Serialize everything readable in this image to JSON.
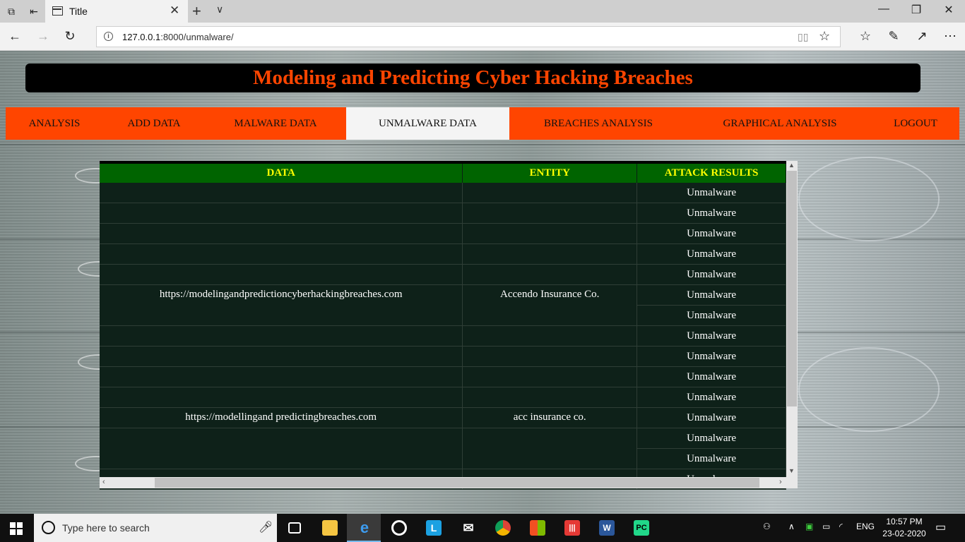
{
  "browser": {
    "tab_title": "Title",
    "url_host": "127.0.0.1",
    "url_rest": ":8000/unmalware/"
  },
  "page": {
    "title": "Modeling and Predicting Cyber Hacking Breaches",
    "menu": [
      {
        "label": "ANALYSIS"
      },
      {
        "label": "ADD DATA"
      },
      {
        "label": "MALWARE DATA"
      },
      {
        "label": "UNMALWARE DATA",
        "active": true
      },
      {
        "label": "BREACHES ANALYSIS"
      },
      {
        "label": "GRAPHICAL ANALYSIS"
      },
      {
        "label": "LOGOUT"
      }
    ],
    "table": {
      "headers": [
        "DATA",
        "ENTITY",
        "ATTACK RESULTS"
      ],
      "groups": [
        {
          "data": "",
          "entity": "",
          "results": [
            "Unmalware"
          ]
        },
        {
          "data": "",
          "entity": "",
          "results": [
            "Unmalware"
          ]
        },
        {
          "data": "",
          "entity": "",
          "results": [
            "Unmalware"
          ]
        },
        {
          "data": "",
          "entity": "",
          "results": [
            "Unmalware"
          ]
        },
        {
          "data": "",
          "entity": "",
          "results": [
            "Unmalware"
          ]
        },
        {
          "data": "https://modelingandpredictioncyberhackingbreaches.com",
          "entity": "Accendo Insurance Co.",
          "results": [
            "Unmalware",
            "Unmalware"
          ]
        },
        {
          "data": "",
          "entity": "",
          "results": [
            "Unmalware"
          ]
        },
        {
          "data": "",
          "entity": "",
          "results": [
            "Unmalware"
          ]
        },
        {
          "data": "",
          "entity": "",
          "results": [
            "Unmalware"
          ]
        },
        {
          "data": "",
          "entity": "",
          "results": [
            "Unmalware"
          ]
        },
        {
          "data": "https://modellingand predictingbreaches.com",
          "entity": "acc insurance co.",
          "results": [
            "Unmalware"
          ]
        },
        {
          "data": "",
          "entity": "",
          "results": [
            "Unmalware",
            "Unmalware"
          ]
        },
        {
          "data": "",
          "entity": "",
          "results": [
            "Unmalware"
          ]
        }
      ]
    }
  },
  "taskbar": {
    "search_placeholder": "Type here to search",
    "language": "ENG",
    "time": "10:57 PM",
    "date": "23-02-2020"
  },
  "colors": {
    "accent": "#ff4500",
    "header_bg": "#006400",
    "header_text": "#ffff00",
    "table_bg": "#0e2119"
  }
}
